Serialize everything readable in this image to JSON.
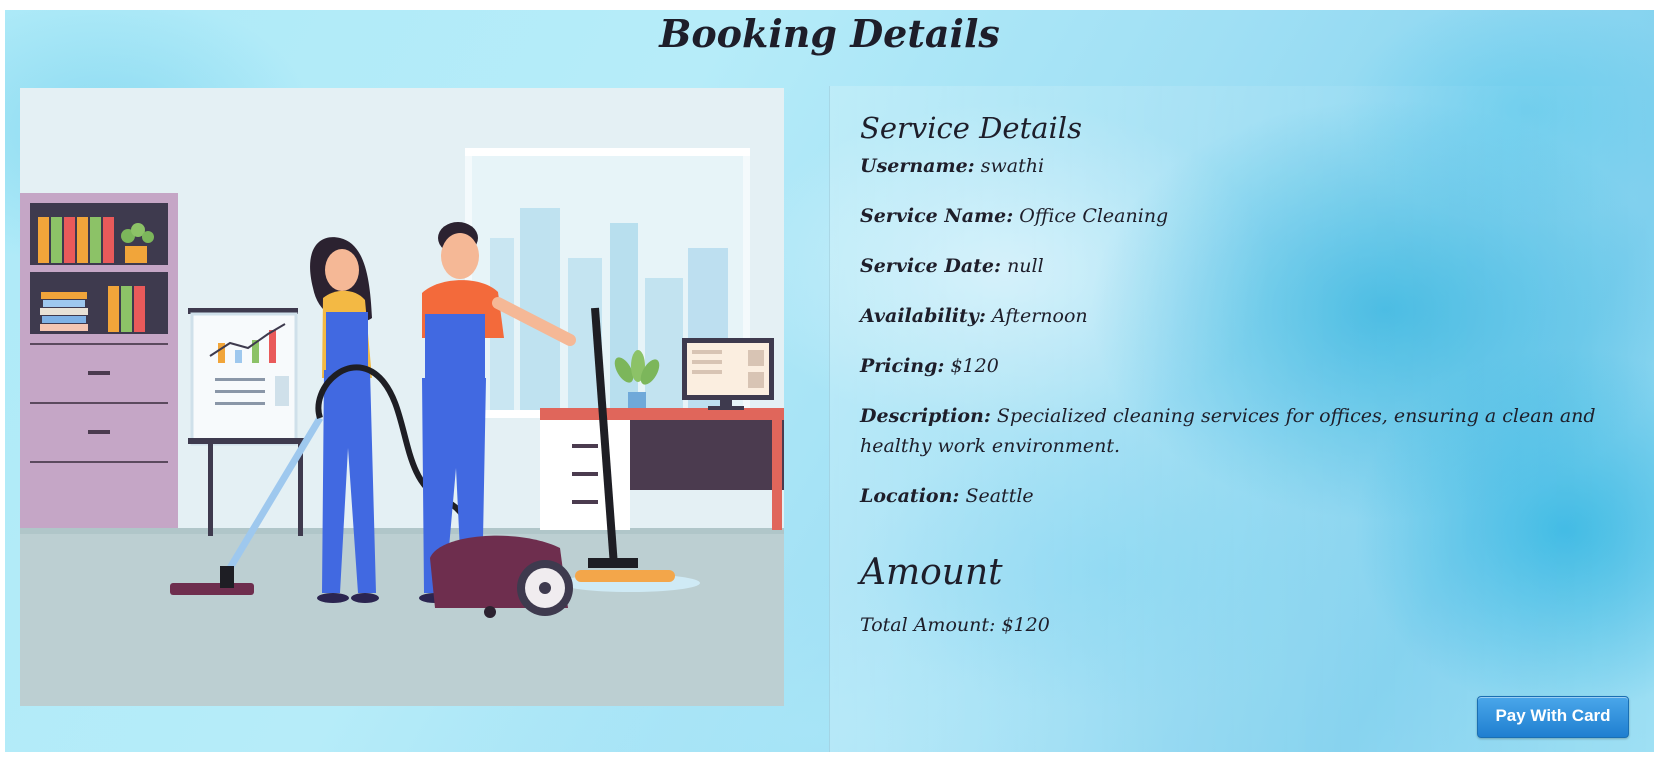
{
  "page": {
    "title": "Booking Details"
  },
  "illustration": {
    "icon": "office-cleaning-illustration"
  },
  "service_details": {
    "heading": "Service Details",
    "fields": [
      {
        "label": "Username:",
        "value": "swathi"
      },
      {
        "label": "Service Name:",
        "value": "Office Cleaning"
      },
      {
        "label": "Service Date:",
        "value": "null"
      },
      {
        "label": "Availability:",
        "value": "Afternoon"
      },
      {
        "label": "Pricing:",
        "value": "$120"
      },
      {
        "label": "Description:",
        "value": "Specialized cleaning services for offices, ensuring a clean and healthy work environment."
      },
      {
        "label": "Location:",
        "value": "Seattle"
      }
    ]
  },
  "amount": {
    "heading": "Amount",
    "total_text": "Total Amount: $120"
  },
  "actions": {
    "pay_label": "Pay With Card"
  },
  "colors": {
    "background_light": "#b6ecf9",
    "background_deep": "#2fb3e0",
    "text": "#1e1e2a",
    "button": "#1f7fd0"
  }
}
